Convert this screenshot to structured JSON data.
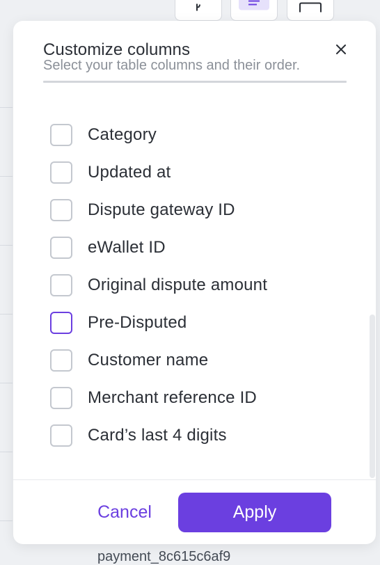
{
  "modal": {
    "title": "Customize columns",
    "subtitle": "Select your table columns and their order.",
    "close_icon": "close-icon"
  },
  "columns": [
    {
      "label": "Category",
      "checked": false,
      "focused": false
    },
    {
      "label": "Updated at",
      "checked": false,
      "focused": false
    },
    {
      "label": "Dispute gateway ID",
      "checked": false,
      "focused": false
    },
    {
      "label": "eWallet ID",
      "checked": false,
      "focused": false
    },
    {
      "label": "Original dispute amount",
      "checked": false,
      "focused": false
    },
    {
      "label": "Pre-Disputed",
      "checked": false,
      "focused": true
    },
    {
      "label": "Customer name",
      "checked": false,
      "focused": false
    },
    {
      "label": "Merchant reference ID",
      "checked": false,
      "focused": false
    },
    {
      "label": "Card’s last 4 digits",
      "checked": false,
      "focused": false
    }
  ],
  "footer": {
    "cancel_label": "Cancel",
    "apply_label": "Apply"
  },
  "background": {
    "footer_text": "payment_8c615c6af9"
  },
  "colors": {
    "accent": "#6b3fe0",
    "text": "#2b2f36",
    "muted": "#8b9098",
    "checkbox_border": "#c4c8cf"
  }
}
